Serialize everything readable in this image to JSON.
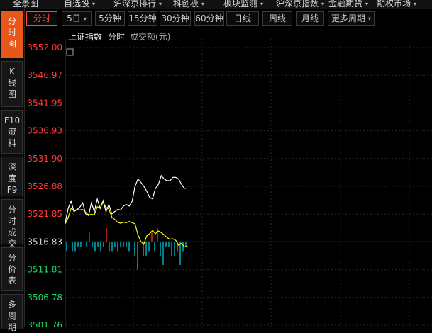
{
  "top_menu": [
    {
      "label": "全景图"
    },
    {
      "label": "自选股",
      "arrow": "▾"
    },
    {
      "label": "沪深京排行",
      "arrow": "▾"
    },
    {
      "label": "科创板",
      "arrow": "▾"
    },
    {
      "label": "板块监测",
      "arrow": "▾"
    },
    {
      "label": "沪深京指数",
      "arrow": "▾"
    },
    {
      "label": "金融期货",
      "arrow": "▾"
    },
    {
      "label": "期权市场",
      "arrow": "▾"
    }
  ],
  "sidebar": [
    {
      "chars": [
        "分",
        "时",
        "图"
      ],
      "active": true
    },
    {
      "chars": [
        "K",
        "线",
        "图"
      ],
      "active": false
    },
    {
      "chars": [
        "F10",
        "资",
        "料"
      ],
      "active": false
    },
    {
      "chars": [
        "深",
        "度",
        "F9"
      ],
      "active": false
    },
    {
      "chars": [
        "分",
        "时",
        "成",
        "交"
      ],
      "active": false
    },
    {
      "chars": [
        "分",
        "价",
        "表"
      ],
      "active": false
    },
    {
      "chars": [
        "多",
        "周",
        "期"
      ],
      "active": false
    }
  ],
  "period_tabs": [
    {
      "label": "分时",
      "active": true,
      "dropdown": false
    },
    {
      "label": "5日",
      "active": false,
      "dropdown": true
    },
    {
      "label": "5分钟",
      "active": false,
      "dropdown": false
    },
    {
      "label": "15分钟",
      "active": false,
      "dropdown": false
    },
    {
      "label": "30分钟",
      "active": false,
      "dropdown": false
    },
    {
      "label": "60分钟",
      "active": false,
      "dropdown": false
    },
    {
      "label": "日线",
      "active": false,
      "dropdown": false
    },
    {
      "label": "周线",
      "active": false,
      "dropdown": false
    },
    {
      "label": "月线",
      "active": false,
      "dropdown": false
    },
    {
      "label": "更多周期",
      "active": false,
      "dropdown": true
    }
  ],
  "chart_header": {
    "name": "上证指数",
    "mode": "分时",
    "volume": "成交额(元)"
  },
  "crosshair_icon": "plus-crosshair",
  "colors": {
    "up": "#ff3b3b",
    "down": "#1fd86a",
    "flat": "#d8d8d8",
    "price": "#ffffff",
    "avg": "#ffff00",
    "bar_down": "#00c8d8",
    "bar_up": "#ff3030",
    "grid": "#2a2a2a"
  },
  "chart_data": {
    "type": "line",
    "ref_price": 3516.83,
    "y_ticks": [
      "3552.00",
      "3546.97",
      "3541.95",
      "3536.93",
      "3531.90",
      "3526.88",
      "3521.85",
      "3516.83",
      "3511.81",
      "3506.78",
      "3501.76"
    ],
    "ylim": [
      3501.76,
      3552.0
    ],
    "series": [
      {
        "values": [
          3520.3,
          3522.9,
          3524.2,
          3522.3,
          3522.7,
          3523.1,
          3523.9,
          3521.9,
          3521.6,
          3523.9,
          3522.3,
          3524.6,
          3522.9,
          3524.3,
          3522.3,
          3523.6,
          3521.9,
          3522.3,
          3522.7,
          3522.6,
          3523.3,
          3523.6,
          3523.3,
          3524.2,
          3526.9,
          3528.2,
          3527.6,
          3526.9,
          3526.0,
          3524.9,
          3524.6,
          3526.5,
          3527.2,
          3528.8,
          3528.2,
          3527.9,
          3527.9,
          3528.5,
          3528.5,
          3528.2,
          3527.2,
          3526.5,
          3526.6
        ],
        "color_key": "price"
      },
      {
        "values": [
          3520.1,
          3521.2,
          3522.9,
          3522.5,
          3522.7,
          3522.6,
          3522.7,
          3522.2,
          3521.7,
          3521.8,
          3521.7,
          3523.2,
          3522.9,
          3524.0,
          3523.1,
          3522.8,
          3521.3,
          3520.9,
          3520.4,
          3520.2,
          3520.4,
          3520.3,
          3520.5,
          3520.3,
          3520.1,
          3518.1,
          3516.9,
          3516.4,
          3517.9,
          3518.3,
          3518.9,
          3518.3,
          3518.8,
          3518.5,
          3518.1,
          3517.6,
          3517.3,
          3517.4,
          3517.1,
          3516.2,
          3516.6,
          3515.9,
          3516.1
        ],
        "color_key": "avg"
      }
    ],
    "bars": [
      -2,
      0,
      -2,
      -2,
      -1,
      -1,
      0,
      -1,
      2,
      -1,
      -2,
      -1,
      -2,
      -1,
      3,
      -2,
      -2,
      -1,
      -2,
      -1,
      -1,
      -1,
      -2,
      0,
      -3,
      -6,
      0,
      -3,
      -3,
      -2,
      2,
      -2,
      3,
      -3,
      -5,
      -1,
      -1,
      -3,
      -3,
      -2,
      -5,
      -2,
      -1
    ]
  }
}
